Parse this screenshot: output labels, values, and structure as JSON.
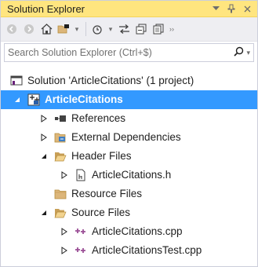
{
  "window": {
    "title": "Solution Explorer",
    "buttons": {
      "dropdown": "▾",
      "pin": "ᵖ",
      "close": "✕"
    }
  },
  "toolbar": {
    "items": [
      "back-icon",
      "forward-icon",
      "home-icon",
      "switch-views-icon",
      "pending-changes-filter-icon",
      "sync-icon",
      "collapse-all-icon",
      "show-all-files-icon",
      "properties-icon"
    ]
  },
  "search": {
    "placeholder": "Search Solution Explorer (Ctrl+$)"
  },
  "tree": {
    "solution": "Solution 'ArticleCitations' (1 project)",
    "project": "ArticleCitations",
    "references": "References",
    "external_dependencies": "External Dependencies",
    "header_files": "Header Files",
    "header_file_1": "ArticleCitations.h",
    "resource_files": "Resource Files",
    "source_files": "Source Files",
    "source_file_1": "ArticleCitations.cpp",
    "source_file_2": "ArticleCitationsTest.cpp"
  },
  "colors": {
    "title_bar": "#ffe57f",
    "selection": "#3399ff",
    "folder": "#dcb67a",
    "cpp_icon": "#9b4f96"
  }
}
